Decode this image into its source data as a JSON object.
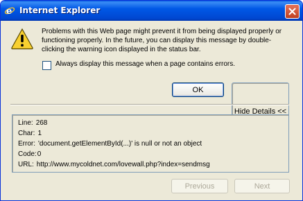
{
  "window": {
    "title": "Internet Explorer",
    "title_icon": "ie-icon",
    "close_icon": "close-icon"
  },
  "message": {
    "icon": "warning-icon",
    "text": "Problems with this Web page might prevent it from being displayed properly or functioning properly. In the future, you can display this message by double-clicking the warning icon displayed in the status bar."
  },
  "checkbox": {
    "label": "Always display this message when a page contains errors.",
    "checked": false
  },
  "buttons": {
    "ok": "OK",
    "hide_details": "Hide Details <<",
    "previous": "Previous",
    "next": "Next"
  },
  "details": {
    "line_label": "Line:",
    "line_value": "268",
    "char_label": "Char:",
    "char_value": "1",
    "error_label": "Error:",
    "error_value": "'document.getElementById(...)' is null or not an object",
    "code_label": "Code:",
    "code_value": "0",
    "url_label": "URL:",
    "url_value": "http://www.mycoldnet.com/lovewall.php?index=sendmsg"
  },
  "colors": {
    "titlebar": "#0058e6",
    "dialog_bg": "#ece9d8",
    "warning_yellow": "#f8d030"
  }
}
